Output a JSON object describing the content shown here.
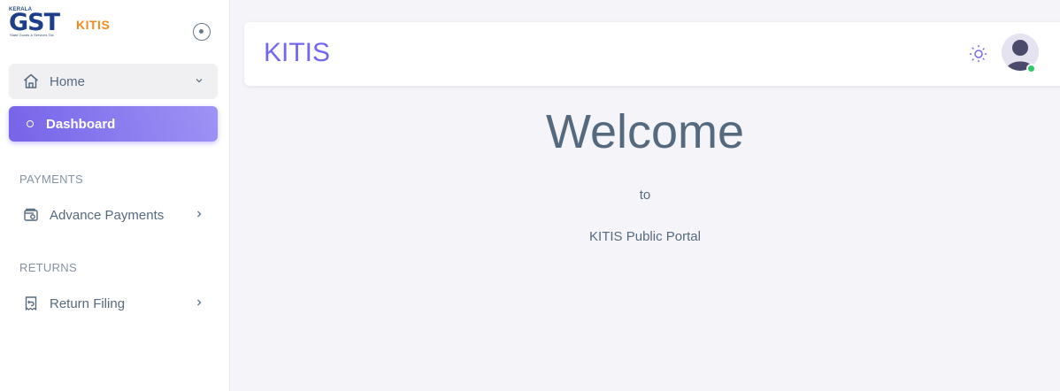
{
  "brand": {
    "logo_kerala": "KERALA",
    "logo_gst": "GST",
    "logo_kitis": "KITIS",
    "logo_subtitle": "State Goods & Services Tax"
  },
  "sidebar": {
    "home_label": "Home",
    "dashboard_label": "Dashboard",
    "payments_section": "PAYMENTS",
    "advance_payments_label": "Advance Payments",
    "returns_section": "RETURNS",
    "return_filing_label": "Return Filing"
  },
  "navbar": {
    "title": "KITIS",
    "accent_color": "#7367f0"
  },
  "main": {
    "welcome": "Welcome",
    "to": "to",
    "portal": "KITIS Public Portal"
  },
  "icons": [
    "home-icon",
    "chevron-down-icon",
    "circle-icon",
    "wallet-icon",
    "chevron-right-icon",
    "receipt-icon",
    "sun-icon",
    "avatar",
    "collapse-icon"
  ]
}
